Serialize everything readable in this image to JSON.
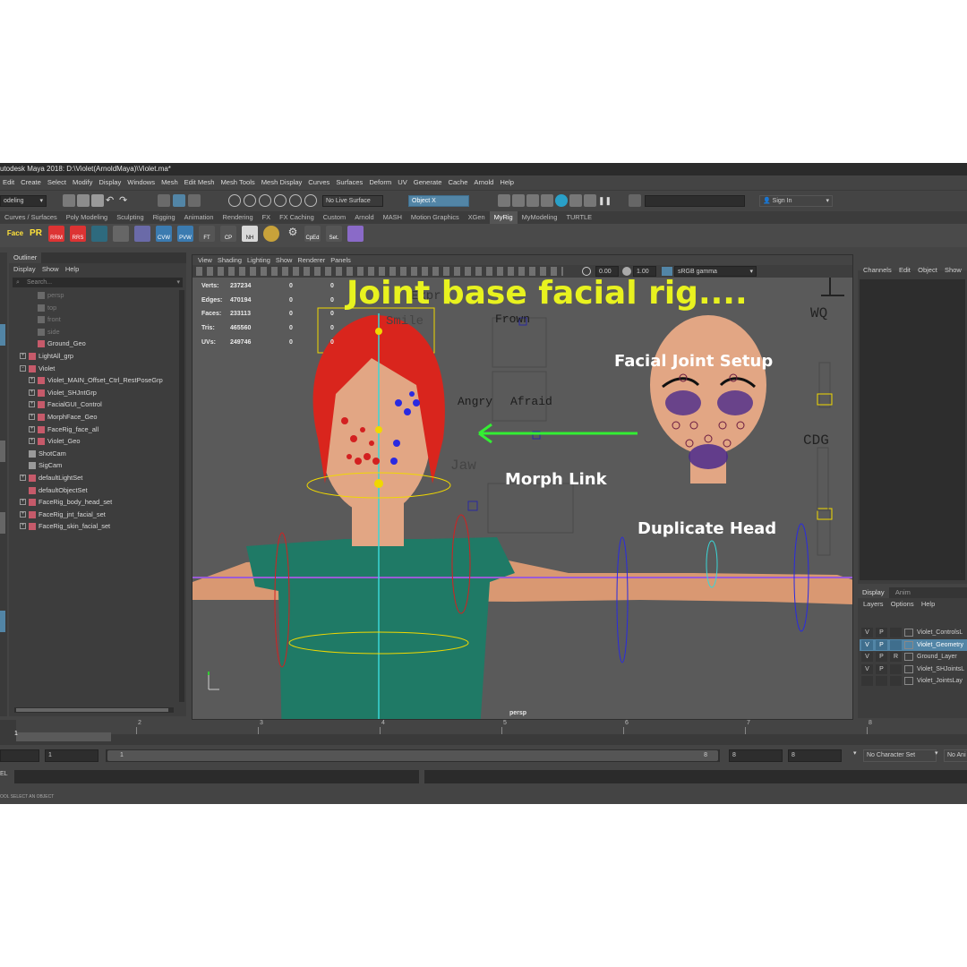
{
  "window": {
    "title": "utodesk Maya 2018: D:\\Violet(ArnoldMaya)\\Violet.ma*"
  },
  "menubar": [
    "Edit",
    "Create",
    "Select",
    "Modify",
    "Display",
    "Windows",
    "Mesh",
    "Edit Mesh",
    "Mesh Tools",
    "Mesh Display",
    "Curves",
    "Surfaces",
    "Deform",
    "UV",
    "Generate",
    "Cache",
    "Arnold",
    "Help"
  ],
  "statusline": {
    "mode": "odeling",
    "live_surface": "No Live Surface",
    "object_field": "Object X",
    "sign_in": "Sign In"
  },
  "shelf_tabs": [
    "Curves / Surfaces",
    "Poly Modeling",
    "Sculpting",
    "Rigging",
    "Animation",
    "Rendering",
    "FX",
    "FX Caching",
    "Custom",
    "Arnold",
    "MASH",
    "Motion Graphics",
    "XGen",
    "MyRig",
    "MyModeling",
    "TURTLE"
  ],
  "shelf_active": "MyRig",
  "shelf_buttons": [
    "Face",
    "PR",
    "RRM",
    "RRS",
    "CVW",
    "PVW",
    "FT",
    "CP",
    "NH",
    "CpEd",
    "Set."
  ],
  "outliner": {
    "tab": "Outliner",
    "menus": [
      "Display",
      "Show",
      "Help"
    ],
    "search_placeholder": "Search...",
    "items": [
      {
        "label": "persp",
        "level": 1,
        "dim": true,
        "exp": ""
      },
      {
        "label": "top",
        "level": 1,
        "dim": true,
        "exp": ""
      },
      {
        "label": "front",
        "level": 1,
        "dim": true,
        "exp": ""
      },
      {
        "label": "side",
        "level": 1,
        "dim": true,
        "exp": ""
      },
      {
        "label": "Ground_Geo",
        "level": 1,
        "dim": false,
        "exp": ""
      },
      {
        "label": "LightAll_grp",
        "level": 0,
        "dim": false,
        "exp": "+"
      },
      {
        "label": "Violet",
        "level": 0,
        "dim": false,
        "exp": "-"
      },
      {
        "label": "Violet_MAIN_Offset_Ctrl_RestPoseGrp",
        "level": 1,
        "dim": false,
        "exp": "+"
      },
      {
        "label": "Violet_SHJntGrp",
        "level": 1,
        "dim": false,
        "exp": "+"
      },
      {
        "label": "FacialGUI_Control",
        "level": 1,
        "dim": false,
        "exp": "+"
      },
      {
        "label": "MorphFace_Geo",
        "level": 1,
        "dim": false,
        "exp": "+"
      },
      {
        "label": "FaceRig_face_all",
        "level": 1,
        "dim": false,
        "exp": "+"
      },
      {
        "label": "Violet_Geo",
        "level": 1,
        "dim": false,
        "exp": "+"
      },
      {
        "label": "ShotCam",
        "level": 0,
        "dim": false,
        "exp": ""
      },
      {
        "label": "SigCam",
        "level": 0,
        "dim": false,
        "exp": ""
      },
      {
        "label": "defaultLightSet",
        "level": 0,
        "dim": false,
        "exp": "+"
      },
      {
        "label": "defaultObjectSet",
        "level": 0,
        "dim": false,
        "exp": ""
      },
      {
        "label": "FaceRig_body_head_set",
        "level": 0,
        "dim": false,
        "exp": "+"
      },
      {
        "label": "FaceRig_jnt_facial_set",
        "level": 0,
        "dim": false,
        "exp": "+"
      },
      {
        "label": "FaceRig_skin_facial_set",
        "level": 0,
        "dim": false,
        "exp": "+"
      }
    ]
  },
  "viewport": {
    "menus": [
      "View",
      "Shading",
      "Lighting",
      "Show",
      "Renderer",
      "Panels"
    ],
    "fields": {
      "exposure": "0.00",
      "gamma": "1.00",
      "color_space": "sRGB gamma"
    },
    "hud": [
      {
        "label": "Verts:",
        "a": "237234",
        "b": "0",
        "c": "0"
      },
      {
        "label": "Edges:",
        "a": "470194",
        "b": "0",
        "c": "0"
      },
      {
        "label": "Faces:",
        "a": "233113",
        "b": "0",
        "c": "0"
      },
      {
        "label": "Tris:",
        "a": "465560",
        "b": "0",
        "c": "0"
      },
      {
        "label": "UVs:",
        "a": "249746",
        "b": "0",
        "c": "0"
      }
    ],
    "camera_label": "persp",
    "gui_labels": [
      "Smile",
      "Frown",
      "Angry",
      "Afraid",
      "WQ",
      "CDG",
      "Jaw",
      "Expr"
    ],
    "overlays": {
      "headline": "Joint base facial rig....",
      "facial_joint_setup": "Facial Joint Setup",
      "morph_link": "Morph Link",
      "duplicate_head": "Duplicate Head"
    }
  },
  "channelbox": {
    "menus": [
      "Channels",
      "Edit",
      "Object",
      "Show"
    ]
  },
  "layers": {
    "tabs": [
      "Display",
      "Anim"
    ],
    "menus": [
      "Layers",
      "Options",
      "Help"
    ],
    "rows": [
      {
        "v": "V",
        "p": "P",
        "r": "",
        "name": "Violet_ControlsL",
        "selected": false
      },
      {
        "v": "V",
        "p": "P",
        "r": "",
        "name": "Violet_Geometry",
        "selected": true
      },
      {
        "v": "V",
        "p": "P",
        "r": "R",
        "name": "Ground_Layer",
        "selected": false
      },
      {
        "v": "V",
        "p": "P",
        "r": "",
        "name": "Violet_SHJointsL",
        "selected": false
      },
      {
        "v": "",
        "p": "",
        "r": "",
        "name": "Violet_JointsLay",
        "selected": false
      }
    ]
  },
  "timeline": {
    "ticks": [
      "1",
      "2",
      "3",
      "4",
      "5",
      "6",
      "7",
      "8"
    ],
    "current_frame": "1",
    "start": "1",
    "range_start": "1",
    "range_end": "8",
    "end_a": "8",
    "end_b": "8",
    "character_set": "No Character Set",
    "anim_layer": "No Ani"
  },
  "cmdline": {
    "label": "EL"
  },
  "helpline": {
    "text": "OOL SELECT AN OBJECT"
  },
  "colors": {
    "accent_blue": "#5285a6",
    "headline": "#e8f21f",
    "arrow": "#33ee33"
  }
}
